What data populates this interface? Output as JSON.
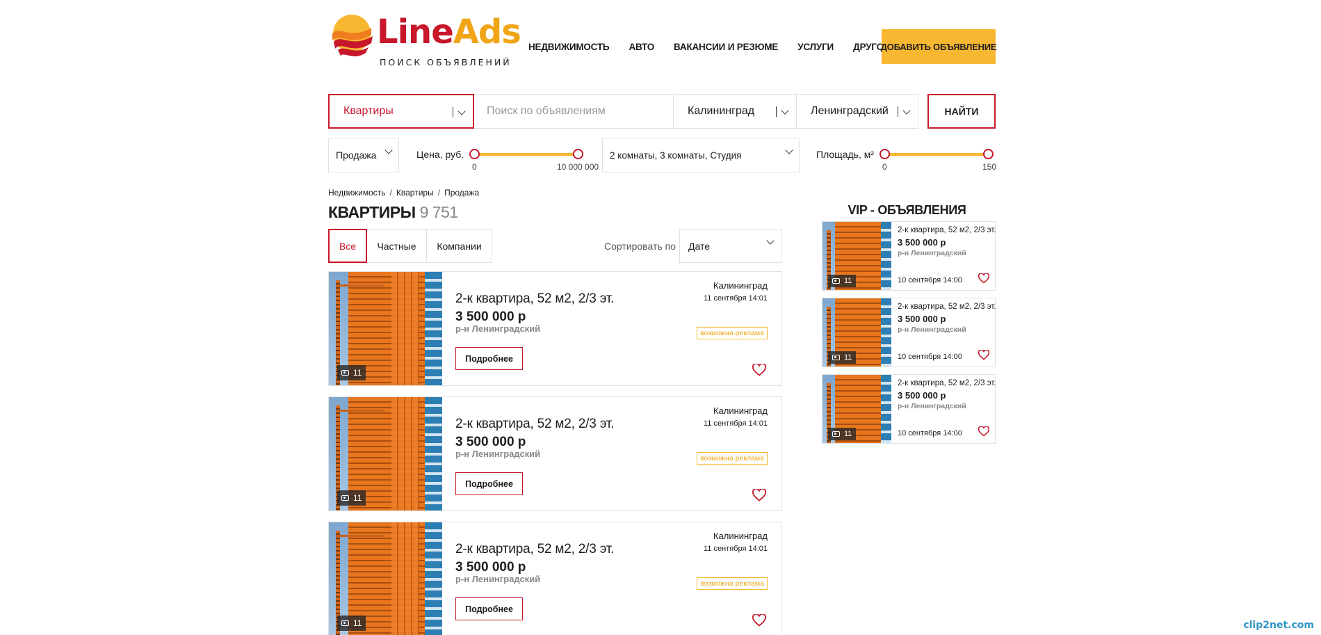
{
  "header": {
    "logo": {
      "brand_line": "Line",
      "brand_ads": "Ads",
      "tagline": "ПОИСК ОБЪЯВЛЕНИЙ"
    },
    "nav": [
      "Недвижимость",
      "Авто",
      "Вакансии и резюме",
      "Услуги",
      "Другое"
    ],
    "add_button": "Добавить объявление"
  },
  "search": {
    "category": "Квартиры",
    "placeholder": "Поиск по объявлениям",
    "city": "Калининград",
    "district": "Ленинградский",
    "find_button": "Найти"
  },
  "filters": {
    "deal_type": "Продажа",
    "price_label": "Цена, руб.",
    "price_min": "0",
    "price_max": "10 000 000",
    "rooms": "2 комнаты, 3 комнаты, Студия",
    "area_label": "Площадь, м²",
    "area_min": "0",
    "area_max": "150"
  },
  "breadcrumbs": [
    "Недвижимость",
    "Квартиры",
    "Продажа"
  ],
  "title": {
    "text": "Квартиры",
    "count": "9 751"
  },
  "tabs": [
    "Все",
    "Частные",
    "Компании"
  ],
  "sort": {
    "label": "Сортировать по",
    "value": "Дате"
  },
  "listings": [
    {
      "title": "2-к квартира, 52 м2, 2/3 эт.",
      "price": "3 500 000 р",
      "district": "р-н Ленинградский",
      "more": "Подробнее",
      "city": "Калининград",
      "date": "11 сентября 14:01",
      "ad_label": "возможна реклама",
      "photos": "11"
    },
    {
      "title": "2-к квартира, 52 м2, 2/3 эт.",
      "price": "3 500 000 р",
      "district": "р-н Ленинградский",
      "more": "Подробнее",
      "city": "Калининград",
      "date": "11 сентября 14:01",
      "ad_label": "возможна реклама",
      "photos": "11"
    },
    {
      "title": "2-к квартира, 52 м2, 2/3 эт.",
      "price": "3 500 000 р",
      "district": "р-н Ленинградский",
      "more": "Подробнее",
      "city": "Калининград",
      "date": "11 сентября 14:01",
      "ad_label": "возможна реклама",
      "photos": "11"
    }
  ],
  "vip": {
    "title": "VIP - объявления",
    "items": [
      {
        "title": "2-к квартира, 52 м2, 2/3 эт.",
        "price": "3 500 000 р",
        "district": "р-н Ленинградский",
        "date": "10 сентября 14:00",
        "photos": "11"
      },
      {
        "title": "2-к квартира, 52 м2, 2/3 эт.",
        "price": "3 500 000 р",
        "district": "р-н Ленинградский",
        "date": "10 сентября 14:00",
        "photos": "11"
      },
      {
        "title": "2-к квартира, 52 м2, 2/3 эт.",
        "price": "3 500 000 р",
        "district": "р-н Ленинградский",
        "date": "10 сентября 14:00",
        "photos": "11"
      }
    ]
  },
  "watermark": "clip2net.com",
  "colors": {
    "brand_red": "#c8162b",
    "brand_yellow": "#f7b731",
    "border": "#e1e1e1"
  }
}
